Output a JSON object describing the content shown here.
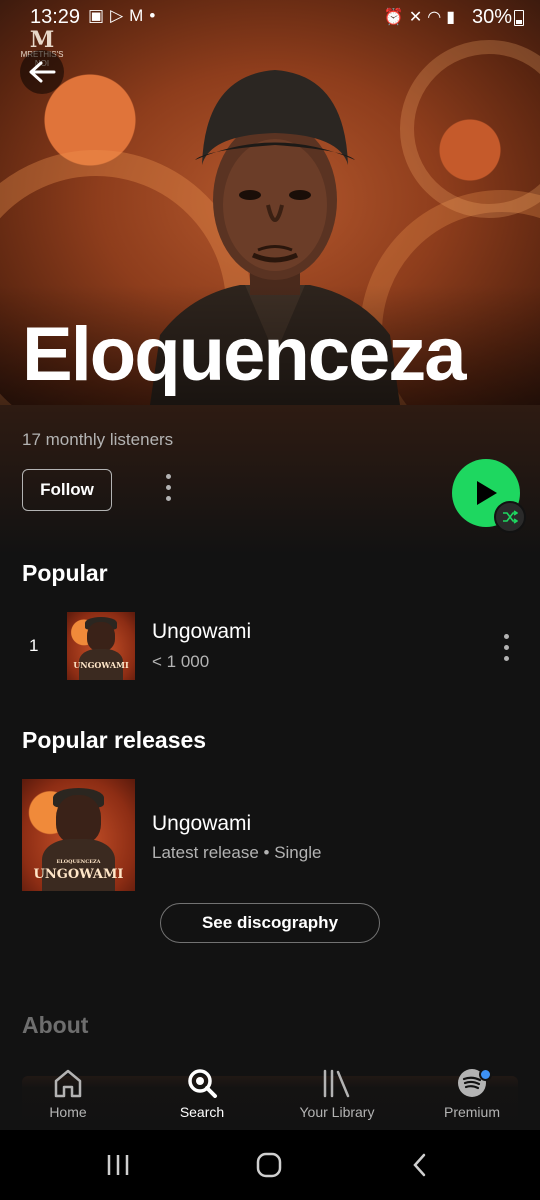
{
  "status_bar": {
    "time": "13:29",
    "left_icons": [
      "gallery-icon",
      "play-store-icon",
      "gmail-icon",
      "dot-icon"
    ],
    "right_icons": [
      "alarm-icon",
      "mute-icon",
      "wifi-icon",
      "signal-icon"
    ],
    "battery": "30%"
  },
  "hero": {
    "logo_text": "MRETHIS'S NOI",
    "artist_name": "Eloquenceza"
  },
  "artist": {
    "monthly_listeners": "17 monthly listeners",
    "follow_label": "Follow"
  },
  "popular": {
    "title": "Popular",
    "tracks": [
      {
        "rank": "1",
        "title": "Ungowami",
        "plays": "< 1 000"
      }
    ]
  },
  "popular_releases": {
    "title": "Popular releases",
    "releases": [
      {
        "title": "Ungowami",
        "subtitle": "Latest release • Single"
      }
    ],
    "see_discography": "See discography"
  },
  "cover_art": {
    "artist_text": "ELOQUENCEZA",
    "title_text": "UNGOWAMI"
  },
  "about": {
    "title": "About"
  },
  "bottom_nav": {
    "items": [
      {
        "label": "Home",
        "icon": "home-icon"
      },
      {
        "label": "Search",
        "icon": "search-icon",
        "active": true
      },
      {
        "label": "Your Library",
        "icon": "library-icon"
      },
      {
        "label": "Premium",
        "icon": "spotify-icon"
      }
    ]
  },
  "colors": {
    "accent_green": "#1ed760",
    "background": "#121212",
    "secondary_text": "#b3b3b3",
    "notification_dot": "#3d91f4"
  }
}
